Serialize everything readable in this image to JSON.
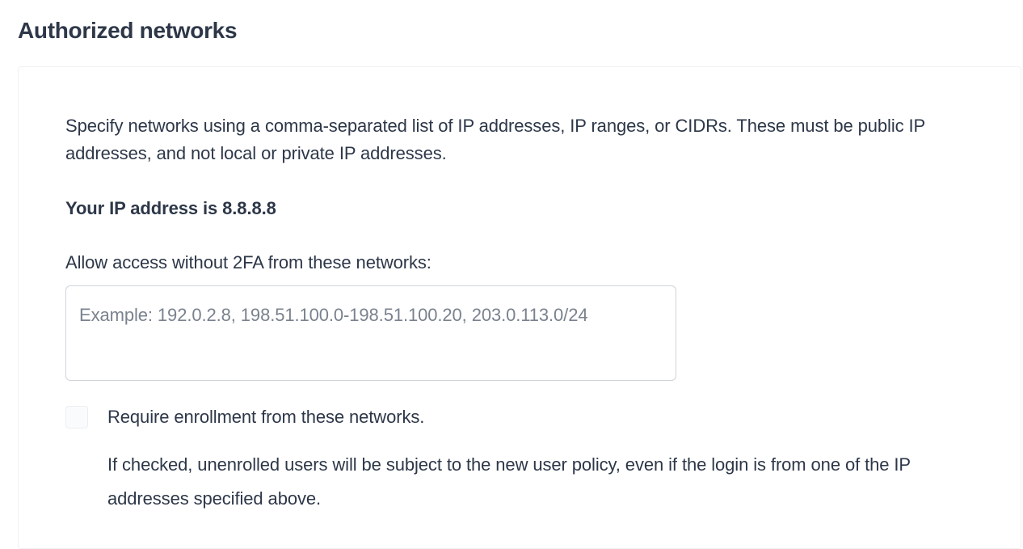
{
  "title": "Authorized networks",
  "panel": {
    "description": "Specify networks using a comma-separated list of IP addresses, IP ranges, or CIDRs. These must be public IP addresses, and not local or private IP addresses.",
    "ip_prefix": "Your IP address is ",
    "ip_address": "8.8.8.8",
    "field_label": "Allow access without 2FA from these networks:",
    "input_placeholder": "Example: 192.0.2.8, 198.51.100.0-198.51.100.20, 203.0.113.0/24",
    "input_value": "",
    "checkbox_label": "Require enrollment from these networks.",
    "checkbox_checked": false,
    "checkbox_hint": "If checked, unenrolled users will be subject to the new user policy, even if the login is from one of the IP addresses specified above."
  }
}
